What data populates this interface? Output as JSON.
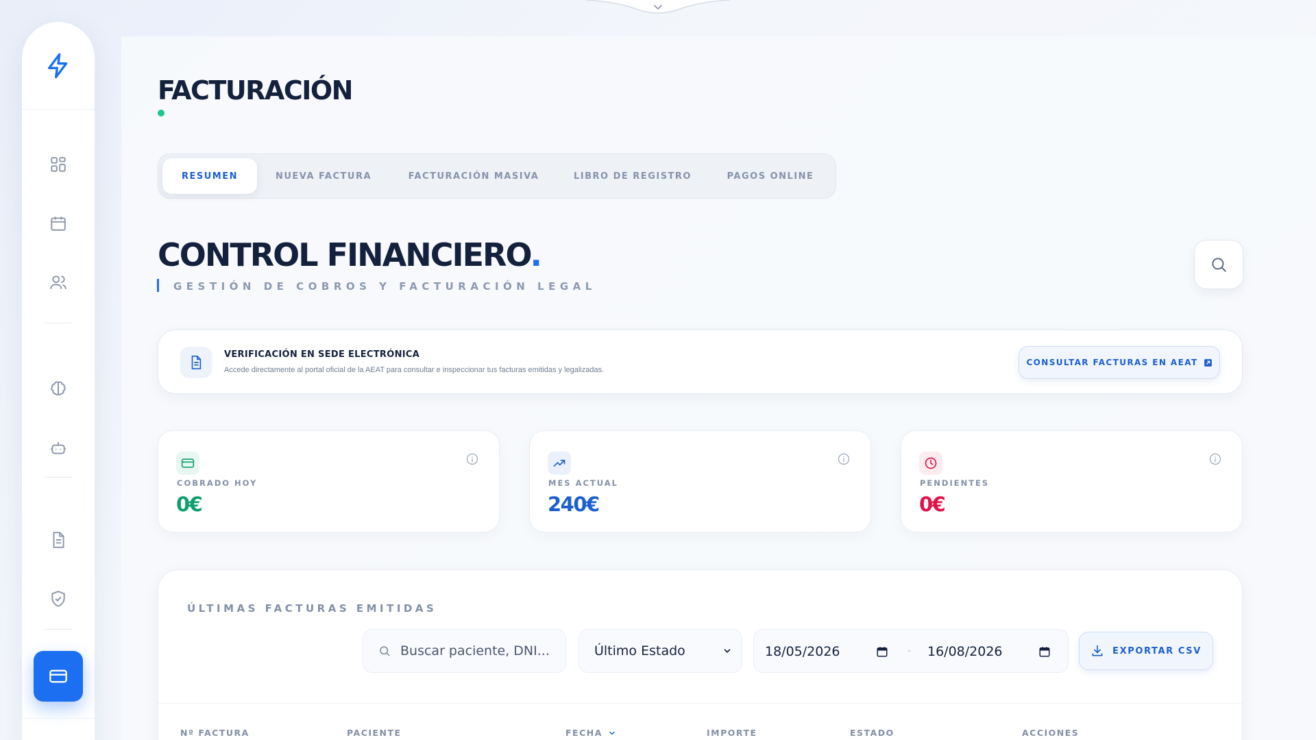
{
  "header": {
    "page_title": "FACTURACIÓN"
  },
  "tabs": [
    {
      "label": "RESUMEN",
      "active": true
    },
    {
      "label": "NUEVA FACTURA",
      "active": false
    },
    {
      "label": "FACTURACIÓN MASIVA",
      "active": false
    },
    {
      "label": "LIBRO DE REGISTRO",
      "active": false
    },
    {
      "label": "PAGOS ONLINE",
      "active": false
    }
  ],
  "section": {
    "title": "CONTROL FINANCIERO",
    "title_dot": ".",
    "subtitle": "GESTIÓN DE COBROS Y FACTURACIÓN LEGAL"
  },
  "sidebar": {
    "logo_icon": "lightning-icon",
    "items": [
      {
        "icon": "dashboard-grid-icon"
      },
      {
        "icon": "calendar-icon"
      },
      {
        "icon": "users-icon"
      },
      {
        "icon": "brain-icon"
      },
      {
        "icon": "robot-icon"
      },
      {
        "icon": "document-icon"
      },
      {
        "icon": "shield-check-icon"
      },
      {
        "icon": "credit-card-icon",
        "active": true
      }
    ]
  },
  "banner": {
    "title": "VERIFICACIÓN EN SEDE ELECTRÓNICA",
    "description": "Accede directamente al portal oficial de la AEAT para consultar e inspeccionar tus facturas emitidas y legalizadas.",
    "button_label": "CONSULTAR FACTURAS EN AEAT"
  },
  "stats": [
    {
      "label": "COBRADO HOY",
      "value": "0€",
      "icon": "credit-card-icon",
      "color": "#0f9f6e"
    },
    {
      "label": "MES ACTUAL",
      "value": "240€",
      "icon": "trending-up-icon",
      "color": "#1d5fcf"
    },
    {
      "label": "PENDIENTES",
      "value": "0€",
      "icon": "clock-icon",
      "color": "#e1124a"
    }
  ],
  "invoices": {
    "title": "ÚLTIMAS FACTURAS EMITIDAS",
    "search_placeholder": "Buscar paciente, DNI...",
    "status_filter": "Último Estado",
    "date_from": "18/05/2026",
    "date_to": "16/08/2026",
    "date_separator": "-",
    "export_label": "EXPORTAR CSV",
    "columns": [
      "Nº FACTURA",
      "PACIENTE",
      "FECHA",
      "IMPORTE",
      "ESTADO",
      "ACCIONES"
    ]
  },
  "colors": {
    "accent": "#1d6ff2",
    "success": "#0f9f6e",
    "danger": "#e1124a",
    "title": "#14213d"
  }
}
